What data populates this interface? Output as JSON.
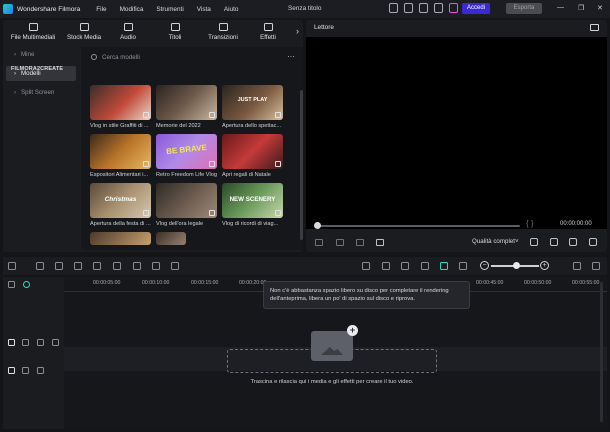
{
  "window": {
    "app_name": "Wondershare Filmora",
    "menu": [
      "File",
      "Modifica",
      "Strumenti",
      "Vista",
      "Aiuto"
    ],
    "doc_title": "Senza titolo",
    "login_label": "Accedi",
    "export_label": "Esporta",
    "controls": [
      "—",
      "❐",
      "✕"
    ]
  },
  "media_tabs": [
    {
      "label": "File Multimediali",
      "icon": "media-icon"
    },
    {
      "label": "Stock Media",
      "icon": "stock-icon"
    },
    {
      "label": "Audio",
      "icon": "music-note-icon"
    },
    {
      "label": "Titoli",
      "icon": "title-icon"
    },
    {
      "label": "Transizioni",
      "icon": "transition-icon"
    },
    {
      "label": "Effetti",
      "icon": "effects-icon"
    }
  ],
  "tabs_more": "›",
  "sidebar": [
    {
      "label": "Mine",
      "active": false
    },
    {
      "label": "Modelli",
      "active": true
    },
    {
      "label": "Split Screen",
      "active": false
    }
  ],
  "search": {
    "placeholder": "Cerca modelli",
    "more": "···"
  },
  "section_title": "FILMORA2CREATE",
  "templates": [
    {
      "caption": "Vlog in stile Graffiti di ...",
      "overlay": ""
    },
    {
      "caption": "Memorie del 2022",
      "overlay": ""
    },
    {
      "caption": "Apertura dello spettac...",
      "overlay": "JUST PLAY"
    },
    {
      "caption": "Espositori Alimentari i...",
      "overlay": ""
    },
    {
      "caption": "Retro Freedom Life Vlog",
      "overlay": "BE BRAVE"
    },
    {
      "caption": "Apri regali di Natale",
      "overlay": ""
    },
    {
      "caption": "Apertura della festa di ...",
      "overlay": "Christmas"
    },
    {
      "caption": "Vlog dell'ora legale",
      "overlay": ""
    },
    {
      "caption": "Vlog di ricordi di viag...",
      "overlay": "NEW SCENERY"
    },
    {
      "caption": "",
      "overlay": ""
    },
    {
      "caption": "",
      "overlay": ""
    }
  ],
  "player": {
    "title": "Lettore",
    "timecode": "00:00:00:00",
    "quality": "Qualità complet˅",
    "progress": 0
  },
  "timeline": {
    "ticks": [
      "00:00:05:00",
      "00:00:10:00",
      "00:00:15:00",
      "00:00:20:00",
      "00:00:45:00",
      "00:00:50:00",
      "00:00:55:00"
    ],
    "tooltip": "Non c'è abbastanza spazio libero su disco per completare il rendering dell'anteprima, libera un po' di spazio sul disco e riprova.",
    "drop_hint": "Trascina e rilascia qui i media e gli effetti per creare il tuo video.",
    "zoom_minus": "−",
    "zoom_plus": "+",
    "drop_plus": "+"
  },
  "colors": {
    "accent_login": "#3a2ad6",
    "accent_teal": "#32d6c4",
    "cart_pink": "#f04ce0"
  }
}
